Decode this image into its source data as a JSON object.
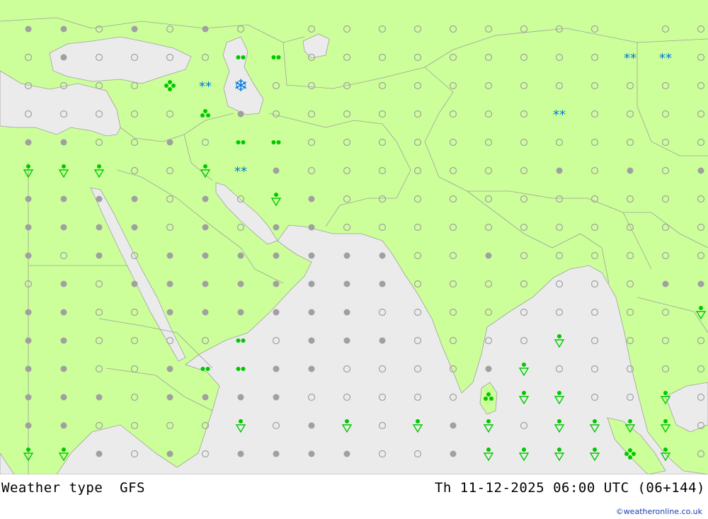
{
  "footer": {
    "title": "Weather type",
    "model": "GFS",
    "valid_time": "Th 11-12-2025 06:00 UTC (06+144)"
  },
  "credit": "©weatheronline.co.uk",
  "colors": {
    "land": "#ccff99",
    "sea": "#ebebeb",
    "border": "#a0a0a0",
    "dot": "#a0a0a0",
    "rain": "#00c800",
    "snow": "#0077dd"
  },
  "legend_symbols": [
    "overcast",
    "cloudy",
    "partly-cloudy",
    "clear",
    "drizzle",
    "rain",
    "rain-shower",
    "snow",
    "heavy-snow"
  ]
}
